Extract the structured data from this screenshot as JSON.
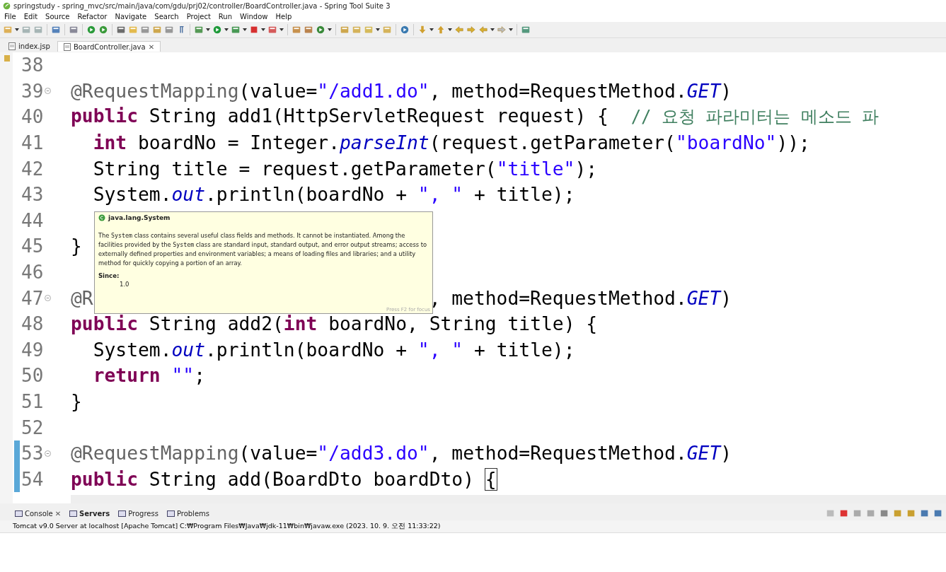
{
  "window": {
    "title": "springstudy - spring_mvc/src/main/java/com/gdu/prj02/controller/BoardController.java - Spring Tool Suite 3"
  },
  "menu": [
    "File",
    "Edit",
    "Source",
    "Refactor",
    "Navigate",
    "Search",
    "Project",
    "Run",
    "Window",
    "Help"
  ],
  "editor_tabs": [
    {
      "label": "index.jsp",
      "selected": false
    },
    {
      "label": "BoardController.java",
      "selected": true,
      "close": "✕"
    }
  ],
  "code_lines": [
    {
      "number": "38",
      "foldable": false,
      "changed": false
    },
    {
      "number": "39",
      "foldable": true,
      "changed": false,
      "tokens": [
        {
          "kind": "ann",
          "text": "@RequestMapping"
        },
        {
          "kind": "plain",
          "text": "(value="
        },
        {
          "kind": "str",
          "text": "\"/add1.do\""
        },
        {
          "kind": "plain",
          "text": ", method=RequestMethod."
        },
        {
          "kind": "static",
          "text": "GET"
        },
        {
          "kind": "plain",
          "text": ")"
        }
      ]
    },
    {
      "number": "40",
      "foldable": false,
      "changed": false,
      "tokens": [
        {
          "kind": "kw",
          "text": "public"
        },
        {
          "kind": "plain",
          "text": " String add1(HttpServletRequest request) {  "
        },
        {
          "kind": "comment",
          "text": "// 요청 파라미터는 메소드 파"
        }
      ]
    },
    {
      "number": "41",
      "foldable": false,
      "changed": false,
      "indented": true,
      "tokens": [
        {
          "kind": "kw",
          "text": "int"
        },
        {
          "kind": "plain",
          "text": " boardNo = Integer."
        },
        {
          "kind": "static",
          "text": "parseInt"
        },
        {
          "kind": "plain",
          "text": "(request.getParameter("
        },
        {
          "kind": "str",
          "text": "\"boardNo\""
        },
        {
          "kind": "plain",
          "text": "));"
        }
      ]
    },
    {
      "number": "42",
      "foldable": false,
      "changed": false,
      "indented": true,
      "tokens": [
        {
          "kind": "plain",
          "text": "String title = request.getParameter("
        },
        {
          "kind": "str",
          "text": "\"title\""
        },
        {
          "kind": "plain",
          "text": ");"
        }
      ]
    },
    {
      "number": "43",
      "foldable": false,
      "changed": false,
      "indented": true,
      "tokens": [
        {
          "kind": "plain",
          "text": "System."
        },
        {
          "kind": "static",
          "text": "out"
        },
        {
          "kind": "plain",
          "text": ".println(boardNo + "
        },
        {
          "kind": "str",
          "text": "\", \""
        },
        {
          "kind": "plain",
          "text": " + title);"
        }
      ]
    },
    {
      "number": "44",
      "foldable": false,
      "changed": false
    },
    {
      "number": "45",
      "foldable": false,
      "changed": false,
      "tokens": [
        {
          "kind": "plain",
          "text": "}"
        }
      ]
    },
    {
      "number": "46",
      "foldable": false,
      "changed": false
    },
    {
      "number": "47",
      "foldable": true,
      "changed": false,
      "tokens": [
        {
          "kind": "ann",
          "text": "@R"
        },
        {
          "kind": "after_overlay",
          "text": ", method=RequestMethod."
        },
        {
          "kind": "static",
          "text": "GET"
        },
        {
          "kind": "plain",
          "text": ")"
        }
      ]
    },
    {
      "number": "48",
      "foldable": false,
      "changed": false,
      "tokens": [
        {
          "kind": "kw",
          "text": "public"
        },
        {
          "kind": "plain",
          "text": " String add2("
        },
        {
          "kind": "kw",
          "text": "int"
        },
        {
          "kind": "plain",
          "text": " boardNo, String title) {"
        }
      ]
    },
    {
      "number": "49",
      "foldable": false,
      "changed": false,
      "indented": true,
      "tokens": [
        {
          "kind": "plain",
          "text": "System."
        },
        {
          "kind": "static",
          "text": "out"
        },
        {
          "kind": "plain",
          "text": ".println(boardNo + "
        },
        {
          "kind": "str",
          "text": "\", \""
        },
        {
          "kind": "plain",
          "text": " + title);"
        }
      ]
    },
    {
      "number": "50",
      "foldable": false,
      "changed": false,
      "indented": true,
      "tokens": [
        {
          "kind": "kw",
          "text": "return"
        },
        {
          "kind": "str",
          "text": " \"\""
        },
        {
          "kind": "plain",
          "text": ";"
        }
      ]
    },
    {
      "number": "51",
      "foldable": false,
      "changed": false,
      "tokens": [
        {
          "kind": "plain",
          "text": "}"
        }
      ]
    },
    {
      "number": "52",
      "foldable": false,
      "changed": false
    },
    {
      "number": "53",
      "foldable": true,
      "changed": true,
      "tokens": [
        {
          "kind": "ann",
          "text": "@RequestMapping"
        },
        {
          "kind": "plain",
          "text": "(value="
        },
        {
          "kind": "str",
          "text": "\"/add3.do\""
        },
        {
          "kind": "plain",
          "text": ", method=RequestMethod."
        },
        {
          "kind": "static",
          "text": "GET"
        },
        {
          "kind": "plain",
          "text": ")"
        }
      ]
    },
    {
      "number": "54",
      "foldable": false,
      "changed": true,
      "tokens": [
        {
          "kind": "kw",
          "text": "public"
        },
        {
          "kind": "plain",
          "text": " String add(BoardDto boardDto) "
        },
        {
          "kind": "bracket",
          "text": "{"
        }
      ]
    }
  ],
  "tooltip": {
    "title": "java.lang.System",
    "description": [
      {
        "code": false,
        "text": "The "
      },
      {
        "code": true,
        "text": "System"
      },
      {
        "code": false,
        "text": " class contains several useful class fields and methods. It cannot be instantiated. Among the facilities provided by the "
      },
      {
        "code": true,
        "text": "System"
      },
      {
        "code": false,
        "text": " class are standard input, standard output, and error output streams; access to externally defined properties and environment variables; a means of loading files and libraries; and a utility method for quickly copying a portion of an array."
      }
    ],
    "since_label": "Since:",
    "since_value": "1.0",
    "footer": "Press F2 for focus"
  },
  "bottom_tabs": [
    {
      "label": "Console",
      "selected": false,
      "close": "✕"
    },
    {
      "label": "Servers",
      "selected": true
    },
    {
      "label": "Progress",
      "selected": false
    },
    {
      "label": "Problems",
      "selected": false
    }
  ],
  "console": {
    "process": "Tomcat v9.0 Server at localhost [Apache Tomcat] C:₩Program Files₩Java₩jdk-11₩bin₩javaw.exe  (2023. 10. 9. 오전 11:33:22)"
  }
}
